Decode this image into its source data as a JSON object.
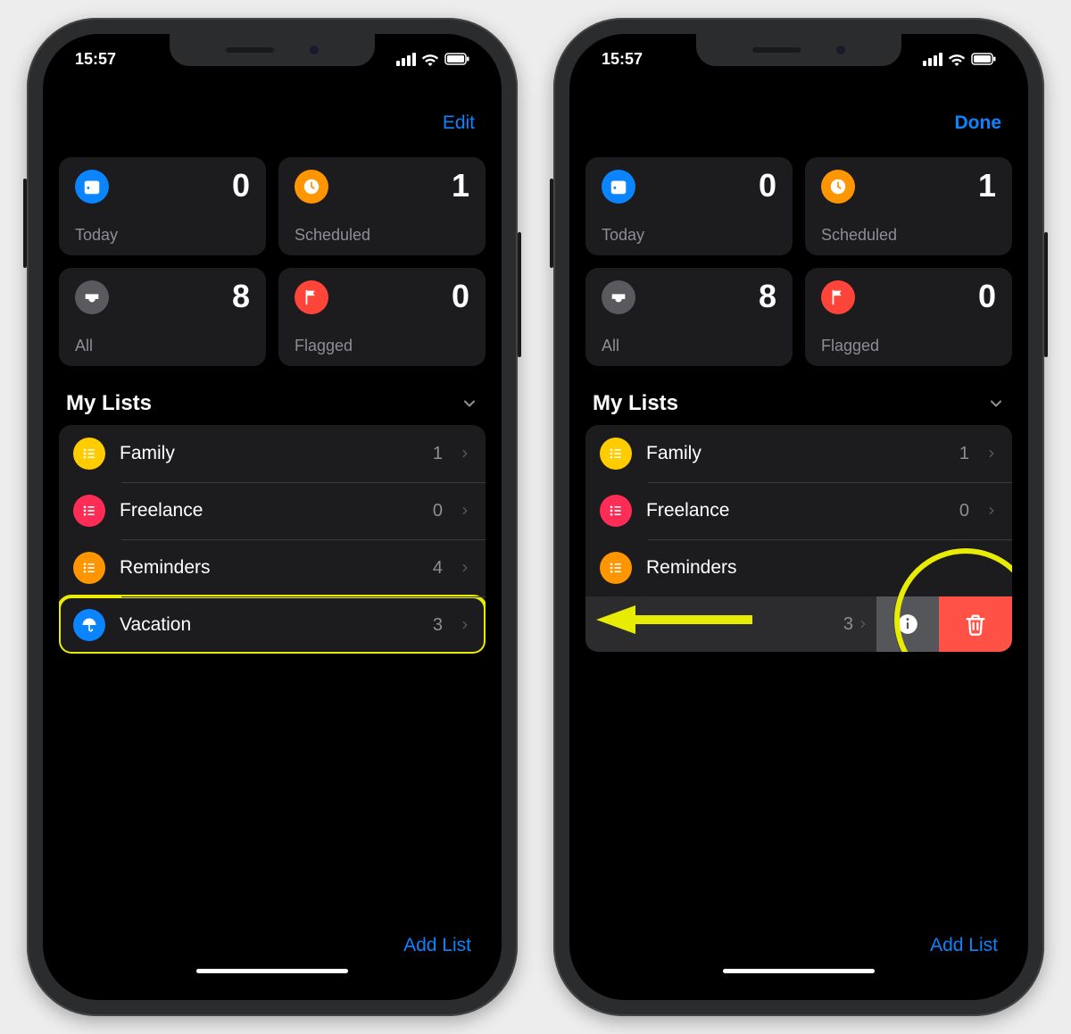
{
  "status": {
    "time": "15:57"
  },
  "left": {
    "navlink": "Edit",
    "tiles": [
      {
        "key": "today",
        "label": "Today",
        "count": "0",
        "color": "#0a84ff",
        "icon": "calendar"
      },
      {
        "key": "scheduled",
        "label": "Scheduled",
        "count": "1",
        "color": "#ff9500",
        "icon": "clock"
      },
      {
        "key": "all",
        "label": "All",
        "count": "8",
        "color": "#5a5a5e",
        "icon": "tray"
      },
      {
        "key": "flagged",
        "label": "Flagged",
        "count": "0",
        "color": "#ff453a",
        "icon": "flag"
      }
    ],
    "section_title": "My Lists",
    "lists": [
      {
        "name": "Family",
        "count": "1",
        "color": "#ffcc00",
        "icon": "list"
      },
      {
        "name": "Freelance",
        "count": "0",
        "color": "#ff2d55",
        "icon": "list"
      },
      {
        "name": "Reminders",
        "count": "4",
        "color": "#ff9500",
        "icon": "list"
      },
      {
        "name": "Vacation",
        "count": "3",
        "color": "#0a84ff",
        "icon": "umbrella",
        "highlight": true
      }
    ],
    "footer": "Add List"
  },
  "right": {
    "navlink": "Done",
    "tiles": [
      {
        "key": "today",
        "label": "Today",
        "count": "0",
        "color": "#0a84ff",
        "icon": "calendar"
      },
      {
        "key": "scheduled",
        "label": "Scheduled",
        "count": "1",
        "color": "#ff9500",
        "icon": "clock"
      },
      {
        "key": "all",
        "label": "All",
        "count": "8",
        "color": "#5a5a5e",
        "icon": "tray"
      },
      {
        "key": "flagged",
        "label": "Flagged",
        "count": "0",
        "color": "#ff453a",
        "icon": "flag"
      }
    ],
    "section_title": "My Lists",
    "lists": [
      {
        "name": "Family",
        "count": "1",
        "color": "#ffcc00",
        "icon": "list"
      },
      {
        "name": "Freelance",
        "count": "0",
        "color": "#ff2d55",
        "icon": "list"
      },
      {
        "name": "Reminders",
        "count": "",
        "color": "#ff9500",
        "icon": "list",
        "hide_trailing": true
      }
    ],
    "swipe": {
      "remaining_count": "3"
    },
    "footer": "Add List"
  }
}
